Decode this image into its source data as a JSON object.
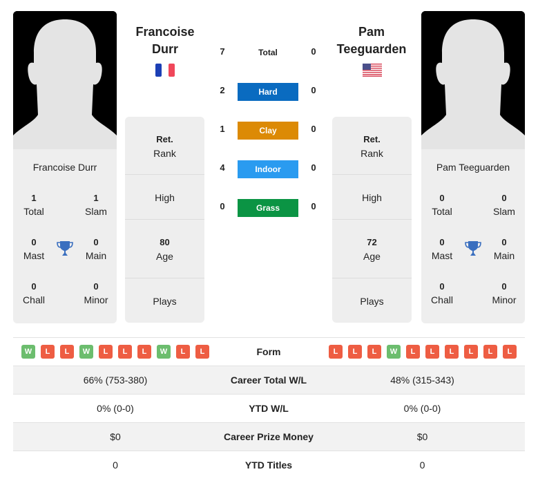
{
  "player1": {
    "name_line1": "Francoise",
    "name_line2": "Durr",
    "full_name": "Francoise Durr",
    "flag": "france-flag",
    "titles": {
      "total": {
        "value": "1",
        "label": "Total"
      },
      "slam": {
        "value": "1",
        "label": "Slam"
      },
      "mast": {
        "value": "0",
        "label": "Mast"
      },
      "main": {
        "value": "0",
        "label": "Main"
      },
      "chall": {
        "value": "0",
        "label": "Chall"
      },
      "minor": {
        "value": "0",
        "label": "Minor"
      }
    },
    "rank": {
      "value": "Ret.",
      "label": "Rank"
    },
    "high": {
      "value": "",
      "label": "High"
    },
    "age": {
      "value": "80",
      "label": "Age"
    },
    "plays": {
      "value": "",
      "label": "Plays"
    },
    "form": [
      "W",
      "L",
      "L",
      "W",
      "L",
      "L",
      "L",
      "W",
      "L",
      "L"
    ],
    "career_wl": "66% (753-380)",
    "ytd_wl": "0% (0-0)",
    "prize_money": "$0",
    "ytd_titles": "0"
  },
  "player2": {
    "name_line1": "Pam",
    "name_line2": "Teeguarden",
    "full_name": "Pam Teeguarden",
    "flag": "usa-flag",
    "titles": {
      "total": {
        "value": "0",
        "label": "Total"
      },
      "slam": {
        "value": "0",
        "label": "Slam"
      },
      "mast": {
        "value": "0",
        "label": "Mast"
      },
      "main": {
        "value": "0",
        "label": "Main"
      },
      "chall": {
        "value": "0",
        "label": "Chall"
      },
      "minor": {
        "value": "0",
        "label": "Minor"
      }
    },
    "rank": {
      "value": "Ret.",
      "label": "Rank"
    },
    "high": {
      "value": "",
      "label": "High"
    },
    "age": {
      "value": "72",
      "label": "Age"
    },
    "plays": {
      "value": "",
      "label": "Plays"
    },
    "form": [
      "L",
      "L",
      "L",
      "W",
      "L",
      "L",
      "L",
      "L",
      "L",
      "L"
    ],
    "career_wl": "48% (315-343)",
    "ytd_wl": "0% (0-0)",
    "prize_money": "$0",
    "ytd_titles": "0"
  },
  "h2h": {
    "total": {
      "label": "Total",
      "p1": "7",
      "p2": "0"
    },
    "surfaces": [
      {
        "label": "Hard",
        "p1": "2",
        "p2": "0",
        "color": "#0a6bc0"
      },
      {
        "label": "Clay",
        "p1": "1",
        "p2": "0",
        "color": "#dc8a05"
      },
      {
        "label": "Indoor",
        "p1": "4",
        "p2": "0",
        "color": "#2a9bf0"
      },
      {
        "label": "Grass",
        "p1": "0",
        "p2": "0",
        "color": "#0b9444"
      }
    ]
  },
  "table": {
    "form_label": "Form",
    "career_wl_label": "Career Total W/L",
    "ytd_wl_label": "YTD W/L",
    "prize_label": "Career Prize Money",
    "ytd_titles_label": "YTD Titles"
  },
  "colors": {
    "win": "#6cbd6e",
    "loss": "#ee5d43",
    "trophy": "#3a6fbf"
  }
}
